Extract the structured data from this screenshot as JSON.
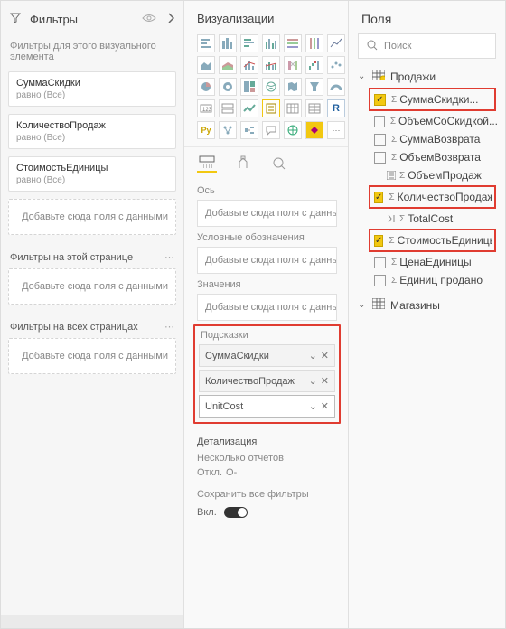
{
  "filters": {
    "title": "Фильтры",
    "subhead": "Фильтры для этого визуального элемента",
    "items": [
      {
        "name": "СуммаСкидки",
        "desc": "равно (Все)"
      },
      {
        "name": "КоличествоПродаж",
        "desc": "равно (Все)"
      },
      {
        "name": "СтоимостьЕдиницы",
        "desc": "равно (Все)"
      }
    ],
    "slot_placeholder": "Добавьте сюда поля с данными",
    "page_section": "Фильтры на этой странице",
    "all_section": "Фильтры на всех страницах"
  },
  "viz": {
    "title": "Визуализации",
    "well_sections": {
      "axis": "Ось",
      "legend": "Условные обозначения",
      "values": "Значения",
      "tooltips": "Подсказки"
    },
    "slot_text": "Добавьте сюда поля с данными",
    "tooltip_chips": [
      "СуммаСкидки",
      "КоличествоПродаж",
      "UnitCost"
    ],
    "drill": "Детализация",
    "cross": "Несколько отчетов",
    "toggle_off": "Откл.",
    "toggle_on": "О-",
    "keep_filters": "Сохранить все фильтры",
    "on_label": "Вкл."
  },
  "fields": {
    "title": "Поля",
    "search_placeholder": "Поиск",
    "tables": [
      {
        "name": "Продажи",
        "expanded": true,
        "fields": [
          {
            "label": "СуммаСкидки...",
            "sigma": true,
            "checked": true,
            "hl": true
          },
          {
            "label": "ОбъемСоСкидкой...",
            "sigma": true,
            "checked": false
          },
          {
            "label": "СуммаВозврата",
            "sigma": true,
            "checked": false
          },
          {
            "label": "ОбъемВозврата",
            "sigma": true,
            "checked": false
          },
          {
            "label": "ОбъемПродаж",
            "calc": true,
            "sigma": false,
            "checked": false,
            "noBox": true
          },
          {
            "label": "КоличествоПродаж",
            "sigma": true,
            "checked": true,
            "hl": true
          },
          {
            "label": "TotalCost",
            "calc2": true,
            "sigma": false,
            "checked": false,
            "noBox": true
          },
          {
            "label": "СтоимостьЕдиницы",
            "sigma": true,
            "checked": true,
            "hl": true
          },
          {
            "label": "ЦенаЕдиницы",
            "sigma": true,
            "checked": false
          },
          {
            "label": "Единиц продано",
            "sigma": true,
            "checked": false
          }
        ]
      },
      {
        "name": "Магазины",
        "expanded": false
      }
    ]
  }
}
